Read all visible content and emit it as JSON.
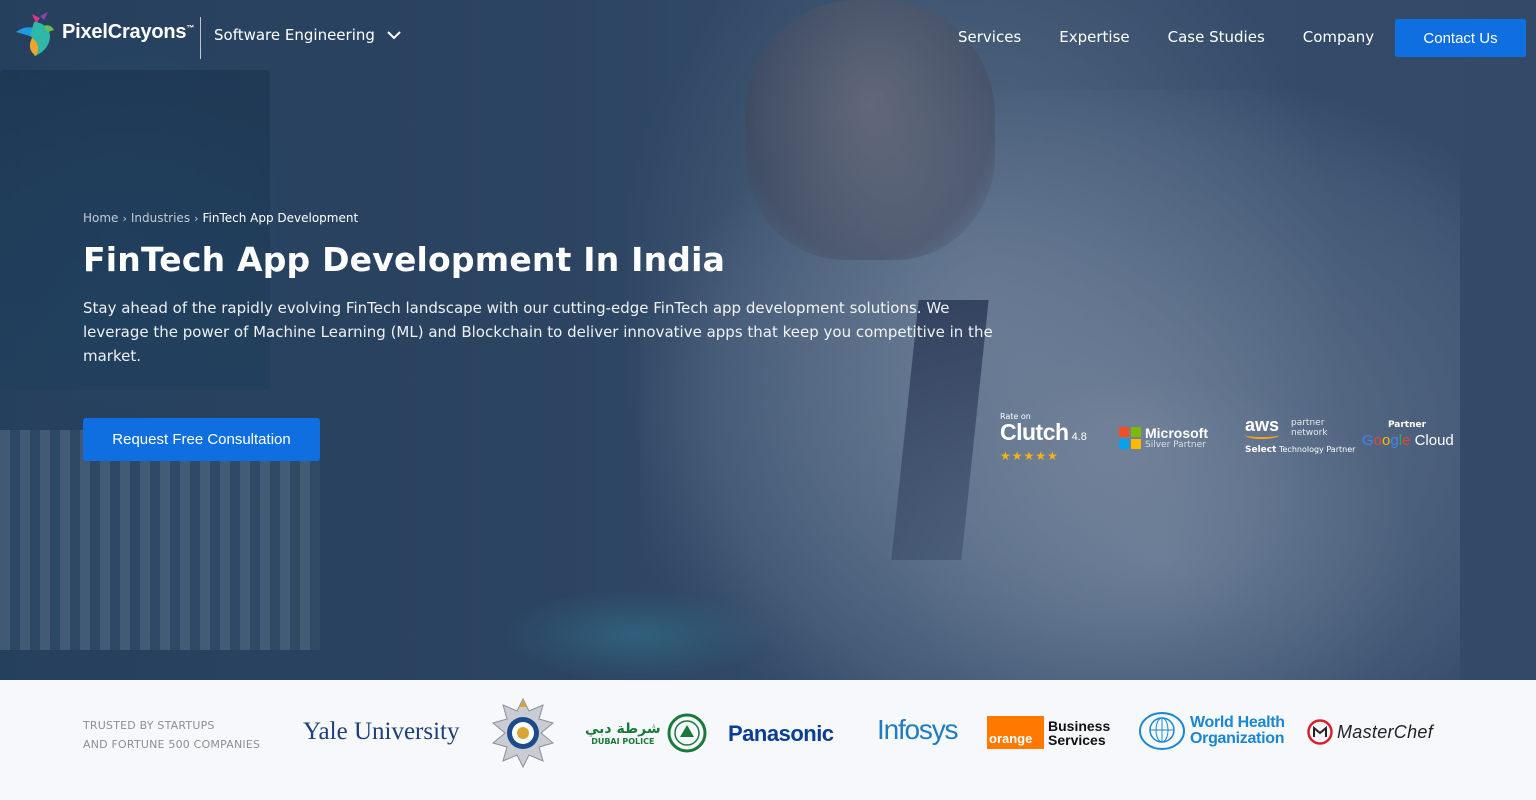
{
  "header": {
    "logo_text": "PixelCrayons",
    "logo_tm": "™",
    "dropdown_label": "Software Engineering",
    "nav_links": [
      "Services",
      "Expertise",
      "Case Studies",
      "Company"
    ],
    "contact_label": "Contact Us"
  },
  "hero": {
    "breadcrumb": [
      "Home",
      "Industries",
      "FinTech App Development"
    ],
    "title": "FinTech App Development In India",
    "description": "Stay ahead of the rapidly evolving FinTech landscape with our cutting-edge FinTech app development solutions. We leverage the power of Machine Learning (ML) and Blockchain to deliver innovative apps that keep you competitive in the market.",
    "cta_label": "Request Free Consultation"
  },
  "badges": {
    "clutch": {
      "rate_on": "Rate on",
      "name": "Clutch",
      "score": "4.8",
      "stars": "★★★★★"
    },
    "microsoft": {
      "name": "Microsoft",
      "sub": "Silver Partner"
    },
    "aws": {
      "logo": "aws",
      "network": "partner network",
      "select": "Select",
      "tier": "Technology Partner"
    },
    "google": {
      "partner": "Partner",
      "cloud": "Cloud"
    }
  },
  "trust": {
    "label_line1": "TRUSTED BY STARTUPS",
    "label_line2": "AND FORTUNE 500 COMPANIES",
    "brands": {
      "yale": "Yale University",
      "dubai_ar": "شرطة دبي",
      "dubai_en": "DUBAI POLICE",
      "panasonic": "Panasonic",
      "infosys": "Infosys",
      "orange_box": "orange",
      "orange_line1": "Business",
      "orange_line2": "Services",
      "who_line1": "World Health",
      "who_line2": "Organization",
      "masterchef": "MasterChef"
    }
  },
  "colors": {
    "primary_button": "#0f6fe0",
    "star": "#f6b40e",
    "trust_bg": "#f6f8fb"
  }
}
